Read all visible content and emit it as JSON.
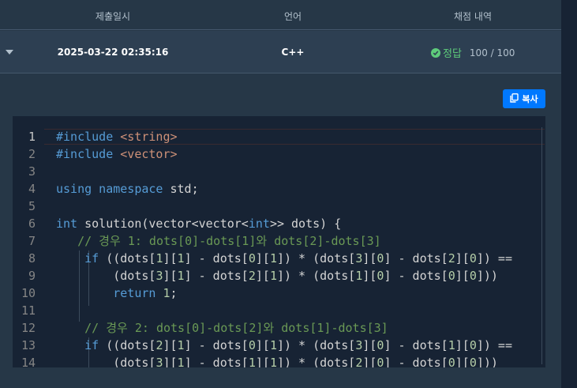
{
  "table": {
    "headers": [
      "제출일시",
      "언어",
      "채점 내역"
    ],
    "row": {
      "datetime": "2025-03-22 02:35:16",
      "language": "C++",
      "result_label": "정답",
      "score": "100 / 100"
    }
  },
  "copy_button": {
    "label": "복사"
  },
  "editor": {
    "current_line": 1,
    "lines": [
      {
        "n": "1",
        "tokens": [
          {
            "c": "kw",
            "t": "#include "
          },
          {
            "c": "str",
            "t": "<string>"
          }
        ]
      },
      {
        "n": "2",
        "tokens": [
          {
            "c": "kw",
            "t": "#include "
          },
          {
            "c": "str",
            "t": "<vector>"
          }
        ]
      },
      {
        "n": "3",
        "tokens": []
      },
      {
        "n": "4",
        "tokens": [
          {
            "c": "kw",
            "t": "using namespace "
          },
          {
            "c": "",
            "t": "std;"
          }
        ]
      },
      {
        "n": "5",
        "tokens": []
      },
      {
        "n": "6",
        "tokens": [
          {
            "c": "kw",
            "t": "int "
          },
          {
            "c": "",
            "t": "solution(vector<vector<"
          },
          {
            "c": "kw",
            "t": "int"
          },
          {
            "c": "",
            "t": ">> dots) {"
          }
        ]
      },
      {
        "n": "7",
        "tokens": [
          {
            "c": "",
            "t": "   "
          },
          {
            "c": "cmt",
            "t": "// 경우 1: dots[0]-dots[1]와 dots[2]-dots[3]"
          }
        ]
      },
      {
        "n": "8",
        "tokens": [
          {
            "c": "",
            "t": "    "
          },
          {
            "c": "kw",
            "t": "if "
          },
          {
            "c": "",
            "t": "((dots["
          },
          {
            "c": "num",
            "t": "1"
          },
          {
            "c": "",
            "t": "]["
          },
          {
            "c": "num",
            "t": "1"
          },
          {
            "c": "",
            "t": "] - dots["
          },
          {
            "c": "num",
            "t": "0"
          },
          {
            "c": "",
            "t": "]["
          },
          {
            "c": "num",
            "t": "1"
          },
          {
            "c": "",
            "t": "]) * (dots["
          },
          {
            "c": "num",
            "t": "3"
          },
          {
            "c": "",
            "t": "]["
          },
          {
            "c": "num",
            "t": "0"
          },
          {
            "c": "",
            "t": "] - dots["
          },
          {
            "c": "num",
            "t": "2"
          },
          {
            "c": "",
            "t": "]["
          },
          {
            "c": "num",
            "t": "0"
          },
          {
            "c": "",
            "t": "]) =="
          }
        ]
      },
      {
        "n": "9",
        "tokens": [
          {
            "c": "",
            "t": "        (dots["
          },
          {
            "c": "num",
            "t": "3"
          },
          {
            "c": "",
            "t": "]["
          },
          {
            "c": "num",
            "t": "1"
          },
          {
            "c": "",
            "t": "] - dots["
          },
          {
            "c": "num",
            "t": "2"
          },
          {
            "c": "",
            "t": "]["
          },
          {
            "c": "num",
            "t": "1"
          },
          {
            "c": "",
            "t": "]) * (dots["
          },
          {
            "c": "num",
            "t": "1"
          },
          {
            "c": "",
            "t": "]["
          },
          {
            "c": "num",
            "t": "0"
          },
          {
            "c": "",
            "t": "] - dots["
          },
          {
            "c": "num",
            "t": "0"
          },
          {
            "c": "",
            "t": "]["
          },
          {
            "c": "num",
            "t": "0"
          },
          {
            "c": "",
            "t": "]))"
          }
        ]
      },
      {
        "n": "10",
        "tokens": [
          {
            "c": "",
            "t": "        "
          },
          {
            "c": "kw",
            "t": "return "
          },
          {
            "c": "num",
            "t": "1"
          },
          {
            "c": "",
            "t": ";"
          }
        ]
      },
      {
        "n": "11",
        "tokens": []
      },
      {
        "n": "12",
        "tokens": [
          {
            "c": "",
            "t": "    "
          },
          {
            "c": "cmt",
            "t": "// 경우 2: dots[0]-dots[2]와 dots[1]-dots[3]"
          }
        ]
      },
      {
        "n": "13",
        "tokens": [
          {
            "c": "",
            "t": "    "
          },
          {
            "c": "kw",
            "t": "if "
          },
          {
            "c": "",
            "t": "((dots["
          },
          {
            "c": "num",
            "t": "2"
          },
          {
            "c": "",
            "t": "]["
          },
          {
            "c": "num",
            "t": "1"
          },
          {
            "c": "",
            "t": "] - dots["
          },
          {
            "c": "num",
            "t": "0"
          },
          {
            "c": "",
            "t": "]["
          },
          {
            "c": "num",
            "t": "1"
          },
          {
            "c": "",
            "t": "]) * (dots["
          },
          {
            "c": "num",
            "t": "3"
          },
          {
            "c": "",
            "t": "]["
          },
          {
            "c": "num",
            "t": "0"
          },
          {
            "c": "",
            "t": "] - dots["
          },
          {
            "c": "num",
            "t": "1"
          },
          {
            "c": "",
            "t": "]["
          },
          {
            "c": "num",
            "t": "0"
          },
          {
            "c": "",
            "t": "]) =="
          }
        ]
      },
      {
        "n": "14",
        "tokens": [
          {
            "c": "",
            "t": "        (dots["
          },
          {
            "c": "num",
            "t": "3"
          },
          {
            "c": "",
            "t": "]["
          },
          {
            "c": "num",
            "t": "1"
          },
          {
            "c": "",
            "t": "] - dots["
          },
          {
            "c": "num",
            "t": "1"
          },
          {
            "c": "",
            "t": "]["
          },
          {
            "c": "num",
            "t": "1"
          },
          {
            "c": "",
            "t": "]) * (dots["
          },
          {
            "c": "num",
            "t": "2"
          },
          {
            "c": "",
            "t": "]["
          },
          {
            "c": "num",
            "t": "0"
          },
          {
            "c": "",
            "t": "] - dots["
          },
          {
            "c": "num",
            "t": "0"
          },
          {
            "c": "",
            "t": "]["
          },
          {
            "c": "num",
            "t": "0"
          },
          {
            "c": "",
            "t": "]))"
          }
        ]
      }
    ]
  },
  "colors": {
    "accent": "#0078ff",
    "success": "#5ecb7b",
    "background": "#263747",
    "editor_bg": "#172334"
  },
  "icons": {
    "expand": "caret-down-icon",
    "result": "check-circle-icon",
    "copy": "copy-icon"
  }
}
